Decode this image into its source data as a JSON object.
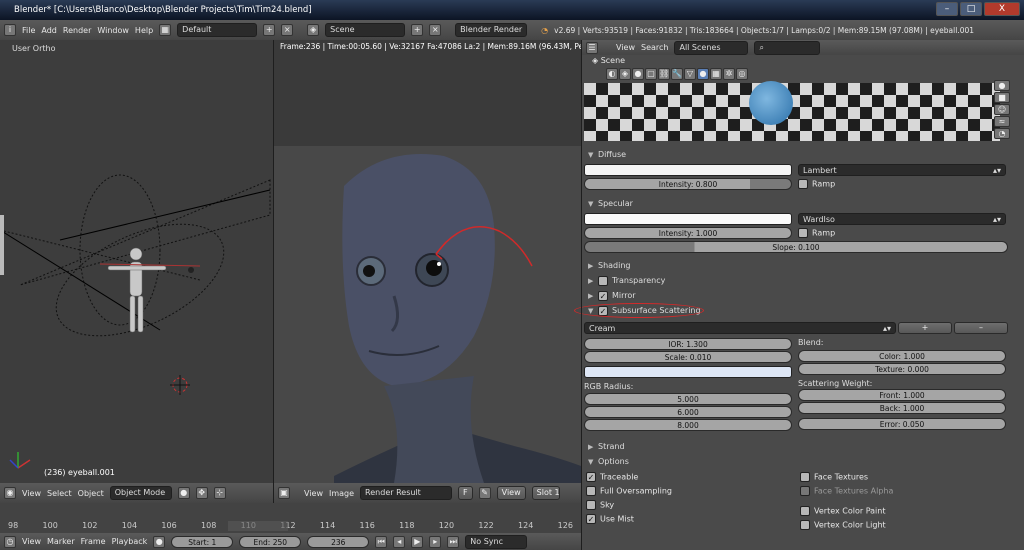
{
  "window": {
    "title": "Blender* [C:\\Users\\Blanco\\Desktop\\Blender Projects\\Tim\\Tim24.blend]",
    "min": "–",
    "max": "□",
    "close": "X"
  },
  "topbar": {
    "menus": [
      "File",
      "Add",
      "Render",
      "Window",
      "Help"
    ],
    "layout": "Default",
    "scene": "Scene",
    "engine": "Blender Render",
    "stats": "v2.69 | Verts:93519 | Faces:91832 | Tris:183664 | Objects:1/7 | Lamps:0/2 | Mem:89.15M (97.08M) | eyeball.001"
  },
  "left_view": {
    "label": "User Ortho",
    "object": "(236) eyeball.001"
  },
  "render_view": {
    "info": "Frame:236 | Time:00:05.60 | Ve:32167 Fa:47086 La:2 | Mem:89.16M (96.43M, Peak 384.3"
  },
  "left_header": {
    "view": "View",
    "select": "Select",
    "object": "Object",
    "mode": "Object Mode"
  },
  "render_header": {
    "view": "View",
    "image": "Image",
    "result": "Render Result",
    "f": "F",
    "view2": "View",
    "slot": "Slot 1"
  },
  "timeline": {
    "ticks": [
      "98",
      "100",
      "102",
      "104",
      "106",
      "108",
      "110",
      "112",
      "114",
      "116",
      "118",
      "120",
      "122",
      "124",
      "126"
    ],
    "view": "View",
    "marker": "Marker",
    "frame": "Frame",
    "playback": "Playback",
    "start": "Start: 1",
    "end": "End: 250",
    "current": "236",
    "sync": "No Sync"
  },
  "props": {
    "view": "View",
    "search": "Search",
    "scenes": "All Scenes",
    "breadcrumb": "Scene",
    "diffuse": {
      "title": "Diffuse",
      "shader": "Lambert",
      "intensity": "Intensity: 0.800",
      "ramp": "Ramp",
      "intensity_frac": 0.8
    },
    "specular": {
      "title": "Specular",
      "shader": "WardIso",
      "intensity": "Intensity: 1.000",
      "ramp": "Ramp",
      "slope": "Slope: 0.100"
    },
    "shading": "Shading",
    "transparency": "Transparency",
    "mirror": "Mirror",
    "sss": {
      "title": "Subsurface Scattering",
      "preset": "Cream",
      "ior": "IOR: 1.300",
      "scale": "Scale: 0.010",
      "rgb_label": "RGB Radius:",
      "r": "5.000",
      "g": "6.000",
      "b": "8.000",
      "blend": "Blend:",
      "color": "Color: 1.000",
      "texture": "Texture: 0.000",
      "weight_label": "Scattering Weight:",
      "front": "Front: 1.000",
      "back": "Back: 1.000",
      "error": "Error: 0.050"
    },
    "strand": "Strand",
    "options": {
      "title": "Options",
      "traceable": "Traceable",
      "full_oversampling": "Full Oversampling",
      "sky": "Sky",
      "use_mist": "Use Mist",
      "face_textures": "Face Textures",
      "face_textures_alpha": "Face Textures Alpha",
      "vertex_color_paint": "Vertex Color Paint",
      "vertex_color_light": "Vertex Color Light"
    }
  }
}
